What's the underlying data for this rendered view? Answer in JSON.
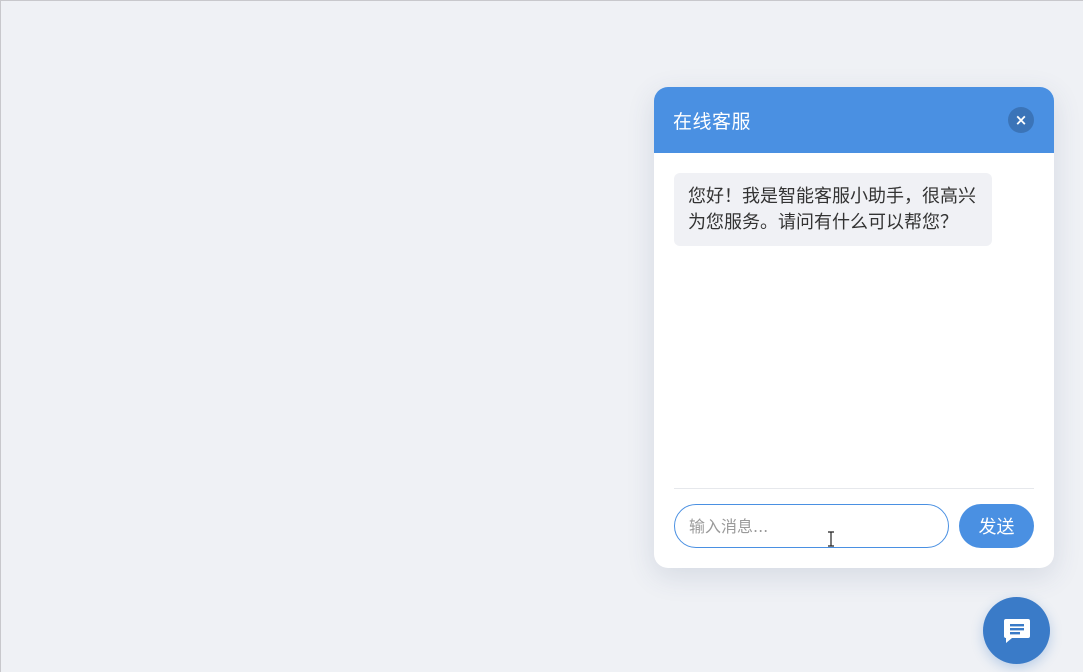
{
  "chat": {
    "title": "在线客服",
    "close_symbol": "×",
    "messages": [
      {
        "sender": "bot",
        "text": "您好！我是智能客服小助手，很高兴为您服务。请问有什么可以帮您？"
      }
    ],
    "input": {
      "value": "",
      "placeholder": "输入消息..."
    },
    "send_label": "发送"
  },
  "icons": {
    "close": "close-icon",
    "chat_launcher": "chat-bubble-icon",
    "cursor": "text-cursor-icon"
  },
  "colors": {
    "page_background": "#eff1f5",
    "header": "#4a90e2",
    "close_button": "#3b74b8",
    "bot_bubble": "#f0f1f5",
    "send_button": "#4a90e2",
    "launcher_button": "#3a7bc8"
  }
}
